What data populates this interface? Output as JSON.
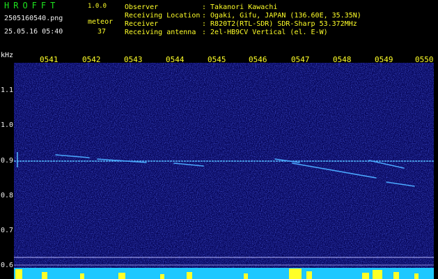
{
  "header": {
    "app_title": "HROFFT",
    "app_version": "1.0.0",
    "file_name": "2505160540.png",
    "datetime": "25.05.16 05:40",
    "meteor_label": "meteor",
    "meteor_count": "37",
    "info": [
      {
        "key": "Observer",
        "value": ": Takanori Kawachi"
      },
      {
        "key": "Receiving Location",
        "value": ": Ogaki, Gifu, JAPAN (136.60E, 35.35N)"
      },
      {
        "key": "Receiver",
        "value": ": R820T2(RTL-SDR) SDR-Sharp 53.372MHz"
      },
      {
        "key": "Receiving antenna",
        "value": ": 2el-HB9CV Vertical (el. E-W)"
      }
    ]
  },
  "axis": {
    "unit": "kHz",
    "x_ticks": [
      "0541",
      "0542",
      "0543",
      "0544",
      "0545",
      "0546",
      "0547",
      "0548",
      "0549",
      "0550"
    ],
    "y_ticks": [
      "1.1",
      "1.0",
      "0.9",
      "0.8",
      "0.7",
      "0.6"
    ]
  },
  "colors": {
    "background": "#000000",
    "spectrogram_bg": "#0a0a6a",
    "carrier": "#66ccff",
    "level_bar": "#ffff28"
  }
}
